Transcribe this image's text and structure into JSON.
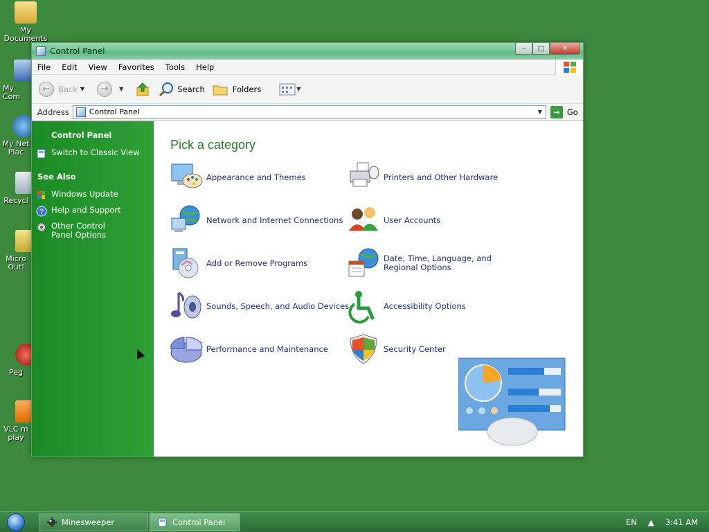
{
  "desktop": {
    "icons": [
      {
        "label": "My Documents"
      },
      {
        "label": "My Com"
      },
      {
        "label": "My Net Plac"
      },
      {
        "label": "Recycl"
      },
      {
        "label": "Micro Outl"
      },
      {
        "label": "Peg"
      },
      {
        "label": "VLC m play"
      }
    ]
  },
  "window": {
    "title": "Control Panel",
    "menu": [
      "File",
      "Edit",
      "View",
      "Favorites",
      "Tools",
      "Help"
    ],
    "toolbar": {
      "back": "Back",
      "search": "Search",
      "folders": "Folders"
    },
    "address": {
      "label": "Address",
      "value": "Control Panel",
      "go": "Go"
    }
  },
  "leftpane": {
    "heading": "Control Panel",
    "switch_link": "Switch to Classic View",
    "see_also": "See Also",
    "links": [
      "Windows Update",
      "Help and Support",
      "Other Control Panel Options"
    ]
  },
  "main": {
    "heading": "Pick a category",
    "categories": [
      {
        "label": "Appearance and Themes",
        "icon": "appearance-icon"
      },
      {
        "label": "Printers and Other Hardware",
        "icon": "printer-icon"
      },
      {
        "label": "Network and Internet Connections",
        "icon": "network-icon"
      },
      {
        "label": "User Accounts",
        "icon": "users-icon"
      },
      {
        "label": "Add or Remove Programs",
        "icon": "programs-icon"
      },
      {
        "label": "Date, Time, Language, and Regional Options",
        "icon": "globe-clock-icon"
      },
      {
        "label": "Sounds, Speech, and Audio Devices",
        "icon": "sound-icon"
      },
      {
        "label": "Accessibility Options",
        "icon": "accessibility-icon"
      },
      {
        "label": "Performance and Maintenance",
        "icon": "pie-chart-icon"
      },
      {
        "label": "Security Center",
        "icon": "shield-icon"
      }
    ]
  },
  "taskbar": {
    "tasks": [
      "Minesweeper",
      "Control Panel"
    ],
    "language": "EN",
    "clock": "3:41 AM"
  }
}
